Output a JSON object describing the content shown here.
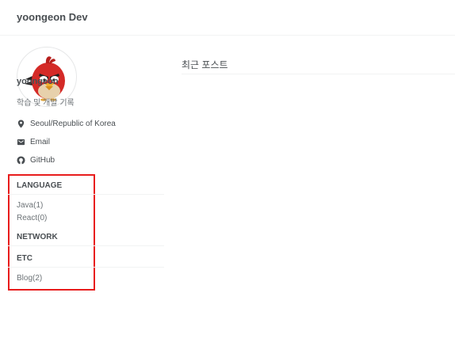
{
  "masthead": {
    "site_title": "yoongeon Dev"
  },
  "author": {
    "name": "yoongeon",
    "bio": "학습 및 개발 기록",
    "links": [
      {
        "label": "Seoul/Republic of Korea",
        "icon": "location-pin-icon"
      },
      {
        "label": "Email",
        "icon": "email-icon"
      },
      {
        "label": "GitHub",
        "icon": "github-icon"
      }
    ]
  },
  "categories": {
    "highlight_color": "#e81c1c",
    "groups": [
      {
        "heading": "LANGUAGE",
        "items": [
          "Java(1)",
          "React(0)"
        ]
      },
      {
        "heading": "NETWORK",
        "items": []
      },
      {
        "heading": "ETC",
        "items": [
          "Blog(2)"
        ]
      }
    ]
  },
  "main": {
    "title": "최근 포스트"
  }
}
